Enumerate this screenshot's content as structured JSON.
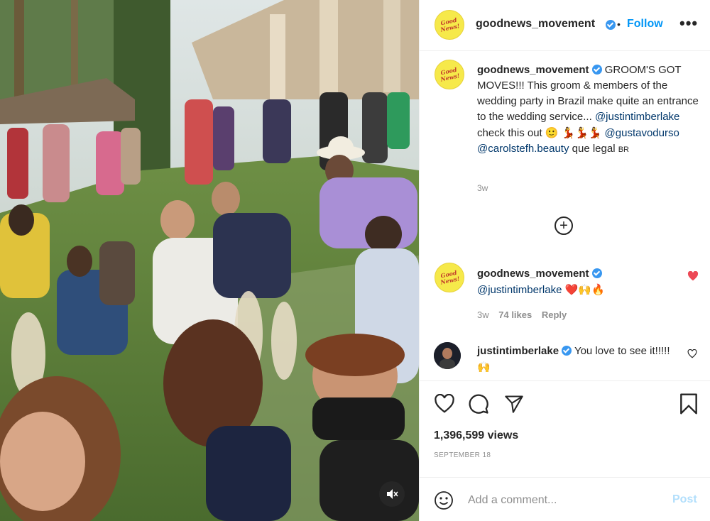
{
  "colors": {
    "accent": "#0095f6",
    "mention": "#00376b",
    "like_red": "#ed4956",
    "secondary": "#8e8e8e",
    "avatar_yellow": "#f6e94a"
  },
  "video": {
    "mute_icon": "speaker-muted-icon"
  },
  "header": {
    "avatar_text": "Good News!",
    "username": "goodnews_movement",
    "separator": "•",
    "follow_label": "Follow",
    "more_label": "•••"
  },
  "caption": {
    "username": "goodnews_movement",
    "headline": "GROOM'S GOT MOVES!!!",
    "body": "This groom & members of the wedding party in Brazil make quite an entrance to the wedding service...",
    "mention1": "@justintimberlake",
    "text2": "check this out",
    "emojis": "🙂 💃💃💃",
    "mention2": "@gustavodurso",
    "mention3": "@carolstefh.beauty",
    "text3": "que legal",
    "country": "BR",
    "time": "3w"
  },
  "load_more_icon": "plus-circle-icon",
  "comments": [
    {
      "username": "goodnews_movement",
      "mention": "@justintimberlake",
      "emojis": "❤️🙌🔥",
      "time": "3w",
      "likes": "74 likes",
      "reply": "Reply",
      "liked": true
    },
    {
      "username": "justintimberlake",
      "text": "You love to see it!!!!!",
      "emojis": "🙌",
      "liked": false
    }
  ],
  "actions": {
    "like_icon": "heart-icon",
    "comment_icon": "comment-icon",
    "share_icon": "paper-plane-icon",
    "save_icon": "bookmark-icon"
  },
  "stats": {
    "views": "1,396,599 views",
    "date": "SEPTEMBER 18"
  },
  "comment_box": {
    "emoji_icon": "smiley-icon",
    "placeholder": "Add a comment...",
    "post_label": "Post"
  }
}
